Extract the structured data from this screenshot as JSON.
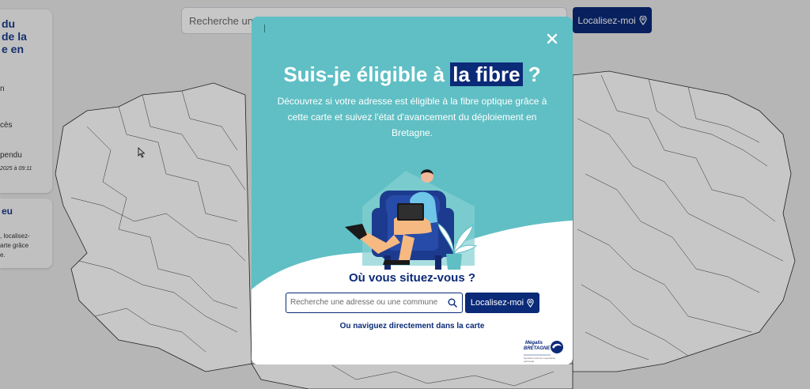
{
  "search": {
    "placeholder": "Recherche une"
  },
  "top_locate": {
    "label": "Localisez-moi"
  },
  "side_panel": {
    "title_lines": [
      "du",
      "de la",
      "e en"
    ],
    "items": [
      "n",
      "cès",
      "pendu"
    ],
    "date": "2025 à 09:11"
  },
  "side_panel2": {
    "title": "eu",
    "lines": [
      ", localisez-",
      "arte grâce",
      "e."
    ]
  },
  "modal": {
    "title_before": "Suis-je éligible à ",
    "title_highlight": "la fibre",
    "title_after": " ?",
    "description": "Découvrez si votre adresse est éligible à la fibre optique grâce à cette carte et suivez l'état d'avancement du déploiement en Bretagne.",
    "question": "Où vous situez-vous ?",
    "search_placeholder": "Recherche une adresse ou une commune",
    "locate_label": "Localisez-moi",
    "browse_link": "Ou naviguez directement dans la carte",
    "logo": {
      "line1": "Mégalis",
      "line2": "BRETAGNE",
      "tagline": "Syndicat mixte de coopération territoriale"
    }
  },
  "colors": {
    "brand_navy": "#0b2a78",
    "modal_teal": "#5fbfc4",
    "overlay": "rgba(0,0,0,0.22)"
  },
  "icons": [
    "close-icon",
    "search-icon",
    "location-pin-icon",
    "cursor-icon"
  ]
}
